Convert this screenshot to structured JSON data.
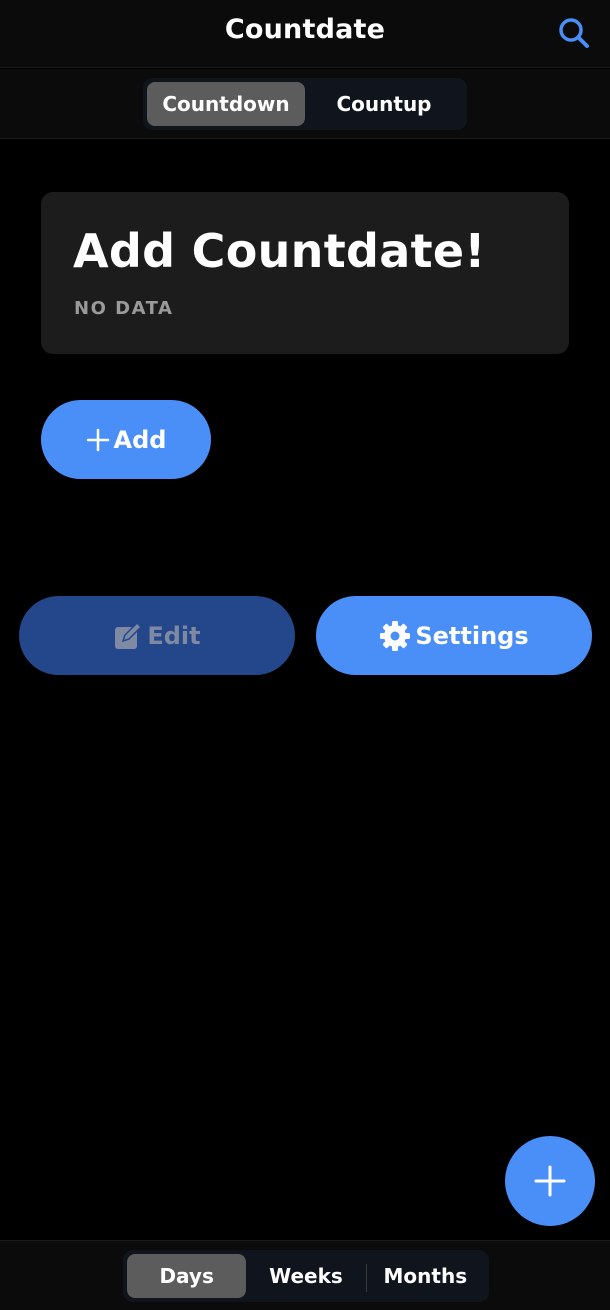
{
  "header": {
    "title": "Countdate",
    "search_icon": "search-icon"
  },
  "mode_tabs": [
    {
      "label": "Countdown",
      "active": true
    },
    {
      "label": "Countup",
      "active": false
    }
  ],
  "card": {
    "title": "Add Countdate!",
    "subtitle": "NO DATA"
  },
  "buttons": {
    "add_label": "Add",
    "edit_label": "Edit",
    "settings_label": "Settings"
  },
  "fab": {
    "icon": "plus-icon"
  },
  "unit_tabs": [
    {
      "label": "Days",
      "active": true
    },
    {
      "label": "Weeks",
      "active": false
    },
    {
      "label": "Months",
      "active": false
    }
  ],
  "colors": {
    "accent": "#4a8ef8",
    "accent_disabled": "#23478a",
    "background": "#000000",
    "card": "#1c1c1c"
  }
}
